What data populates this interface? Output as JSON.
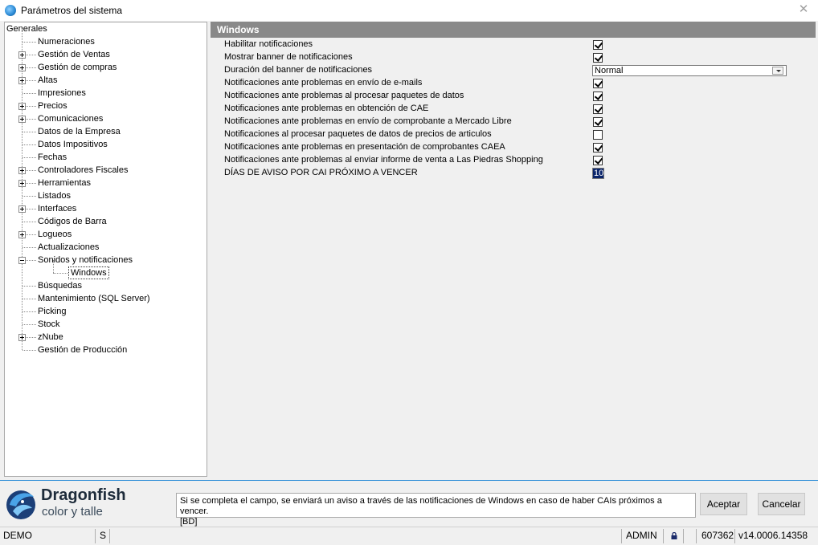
{
  "window": {
    "title": "Parámetros del sistema"
  },
  "tree": {
    "root": "Generales",
    "items": [
      {
        "label": "Numeraciones",
        "expandable": false
      },
      {
        "label": "Gestión de Ventas",
        "expandable": true
      },
      {
        "label": "Gestión de compras",
        "expandable": true
      },
      {
        "label": "Altas",
        "expandable": true
      },
      {
        "label": "Impresiones",
        "expandable": false
      },
      {
        "label": "Precios",
        "expandable": true
      },
      {
        "label": "Comunicaciones",
        "expandable": true
      },
      {
        "label": "Datos de la Empresa",
        "expandable": false
      },
      {
        "label": "Datos Impositivos",
        "expandable": false
      },
      {
        "label": "Fechas",
        "expandable": false
      },
      {
        "label": "Controladores Fiscales",
        "expandable": true
      },
      {
        "label": "Herramientas",
        "expandable": true
      },
      {
        "label": "Listados",
        "expandable": false
      },
      {
        "label": "Interfaces",
        "expandable": true
      },
      {
        "label": "Códigos de Barra",
        "expandable": false
      },
      {
        "label": "Logueos",
        "expandable": true
      },
      {
        "label": "Actualizaciones",
        "expandable": false
      },
      {
        "label": "Sonidos y notificaciones",
        "expandable": true,
        "expanded": true
      },
      {
        "label": "Windows",
        "child": true,
        "selected": true
      },
      {
        "label": "Búsquedas",
        "expandable": false
      },
      {
        "label": "Mantenimiento (SQL Server)",
        "expandable": false
      },
      {
        "label": "Picking",
        "expandable": false
      },
      {
        "label": "Stock",
        "expandable": false
      },
      {
        "label": "zNube",
        "expandable": true
      },
      {
        "label": "Gestión de Producción",
        "expandable": false
      }
    ]
  },
  "section": {
    "title": "Windows",
    "settings": [
      {
        "label": "Habilitar notificaciones",
        "type": "checkbox",
        "checked": true
      },
      {
        "label": "Mostrar banner de notificaciones",
        "type": "checkbox",
        "checked": true
      },
      {
        "label": "Duración del banner de notificaciones",
        "type": "select",
        "value": "Normal"
      },
      {
        "label": "Notificaciones ante problemas en envío de e-mails",
        "type": "checkbox",
        "checked": true
      },
      {
        "label": "Notificaciones ante problemas al procesar paquetes de datos",
        "type": "checkbox",
        "checked": true
      },
      {
        "label": "Notificaciones ante problemas en obtención de CAE",
        "type": "checkbox",
        "checked": true
      },
      {
        "label": "Notificaciones ante problemas en envío de comprobante a Mercado Libre",
        "type": "checkbox",
        "checked": true
      },
      {
        "label": "Notificaciones al procesar paquetes de datos de precios de articulos",
        "type": "checkbox",
        "checked": false
      },
      {
        "label": "Notificaciones ante problemas en presentación de comprobantes CAEA",
        "type": "checkbox",
        "checked": true
      },
      {
        "label": "Notificaciones ante problemas al enviar informe de venta a Las Piedras Shopping",
        "type": "checkbox",
        "checked": true
      },
      {
        "label": "DÍAS DE AVISO POR CAI PRÓXIMO A VENCER",
        "type": "number",
        "value": "10"
      }
    ]
  },
  "brand": {
    "name": "Dragonfish",
    "subtitle": "color y talle"
  },
  "help": {
    "text": "Si se completa el campo, se enviará un aviso a través de las notificaciones de Windows en caso de haber CAIs próximos a vencer.",
    "code": "[BD]"
  },
  "buttons": {
    "accept": "Aceptar",
    "cancel": "Cancelar"
  },
  "status": {
    "db": "DEMO",
    "mode": "S",
    "user": "ADMIN",
    "id": "607362",
    "version": "v14.0006.14358"
  }
}
